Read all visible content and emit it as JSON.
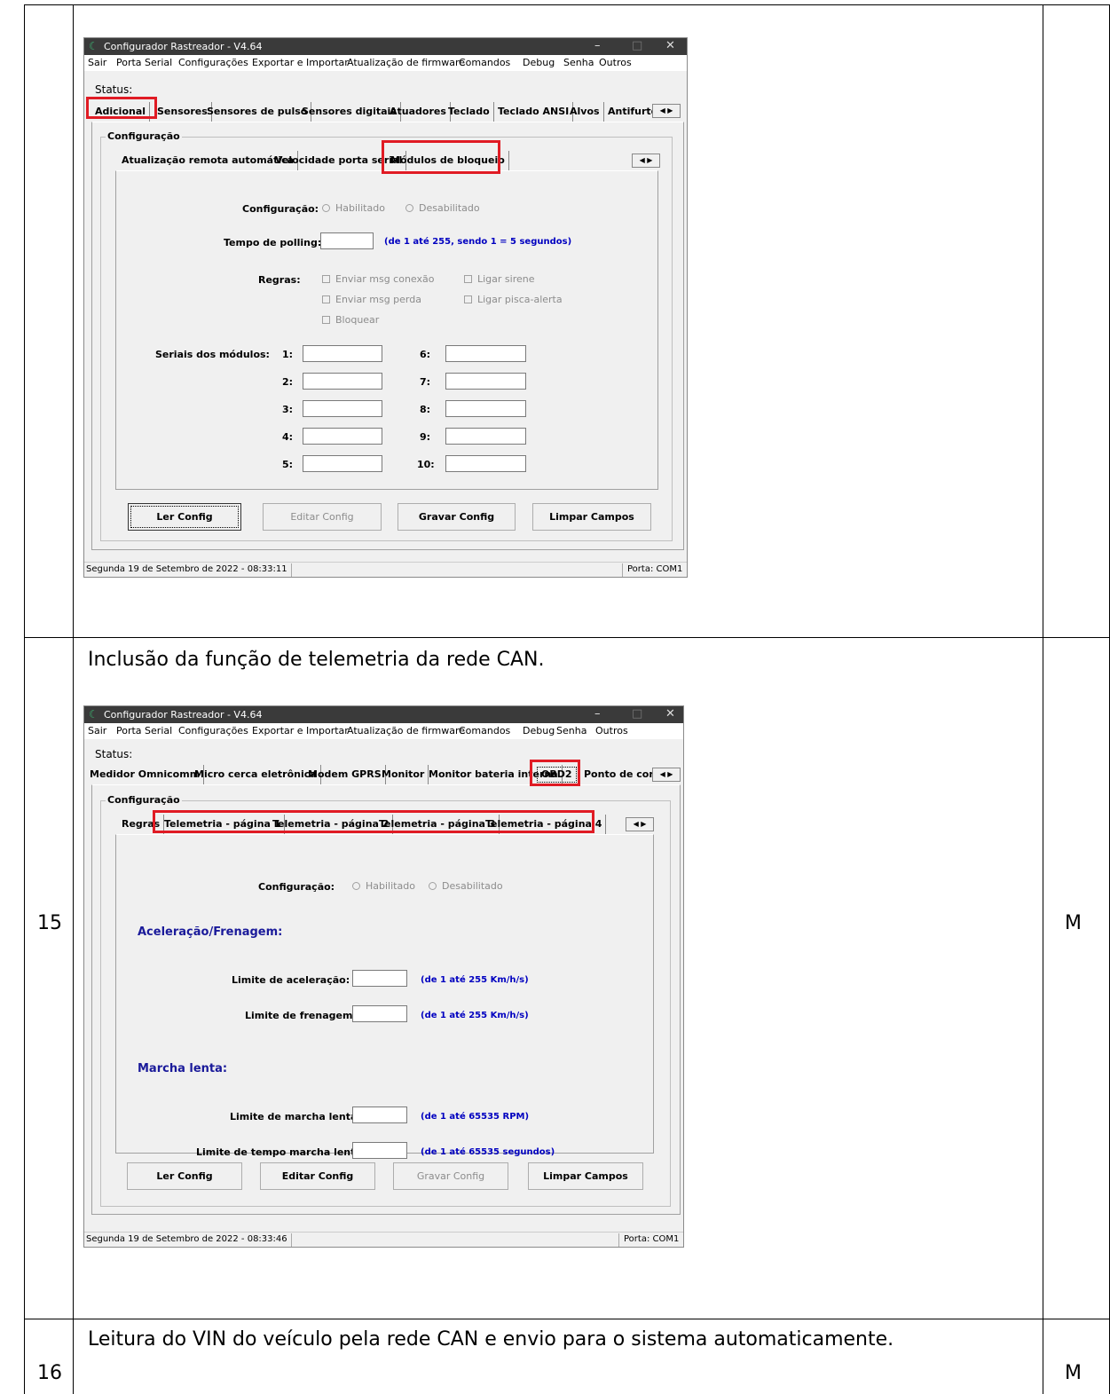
{
  "table": {
    "row1": {
      "num": "",
      "mark": ""
    },
    "row2": {
      "num": "15",
      "mark": "M",
      "description": "Inclusão da função de telemetria da rede CAN."
    },
    "row3": {
      "num": "16",
      "mark": "M",
      "description": "Leitura do VIN do veículo pela rede CAN e envio para o sistema automaticamente."
    }
  },
  "window": {
    "title": "Configurador Rastreador - V4.64",
    "menu": [
      "Sair",
      "Porta Serial",
      "Configurações",
      "Exportar e Importar",
      "Atualização de firmware",
      "Comandos",
      "Debug",
      "Senha",
      "Outros"
    ],
    "status_label": "Status:",
    "group_label": "Configuração",
    "port": "Porta: COM1"
  },
  "shot1": {
    "main_tabs": [
      "Adicional",
      "Sensores",
      "Sensores de pulso",
      "Sensores digitais",
      "Atuadores",
      "Teclado",
      "Teclado ANSI",
      "Alvos",
      "Antifurto"
    ],
    "sub_tabs": [
      "Atualização remota automática",
      "Velocidade porta serial",
      "Módulos de bloqueio"
    ],
    "config_label": "Configuração:",
    "radio_on": "Habilitado",
    "radio_off": "Desabilitado",
    "polling_label": "Tempo de polling:",
    "polling_hint": "(de 1 até 255, sendo 1 = 5 segundos)",
    "rules_label": "Regras:",
    "rules": [
      "Enviar msg conexão",
      "Ligar sirene",
      "Enviar msg perda",
      "Ligar pisca-alerta",
      "Bloquear"
    ],
    "serials_label": "Seriais dos módulos:",
    "serial_nums": [
      "1:",
      "2:",
      "3:",
      "4:",
      "5:",
      "6:",
      "7:",
      "8:",
      "9:",
      "10:"
    ],
    "buttons": [
      "Ler Config",
      "Editar Config",
      "Gravar Config",
      "Limpar Campos"
    ],
    "datetime": "Segunda 19 de Setembro de 2022  -  08:33:11"
  },
  "shot2": {
    "main_tabs": [
      "Medidor Omnicomm",
      "Micro cerca eletrônica",
      "Modem GPRS",
      "Monitor",
      "Monitor bateria interna",
      "OBD2",
      "Ponto de cont"
    ],
    "sub_tabs": [
      "Regras",
      "Telemetria - página 1",
      "Telemetria - página 2",
      "Telemetria - página 3",
      "Telemetria - página 4"
    ],
    "config_label": "Configuração:",
    "radio_on": "Habilitado",
    "radio_off": "Desabilitado",
    "section1": "Aceleração/Frenagem:",
    "accel_label": "Limite de aceleração:",
    "accel_hint": "(de 1 até 255 Km/h/s)",
    "brake_label": "Limite de frenagem:",
    "brake_hint": "(de 1 até 255 Km/h/s)",
    "section2": "Marcha lenta:",
    "idle_label": "Limite de marcha lenta:",
    "idle_hint": "(de 1 até 65535 RPM)",
    "idle_time_label": "Limite de tempo marcha lenta:",
    "idle_time_hint": "(de 1 até 65535 segundos)",
    "buttons": [
      "Ler Config",
      "Editar Config",
      "Gravar Config",
      "Limpar Campos"
    ],
    "datetime": "Segunda 19 de Setembro de 2022  -  08:33:46"
  }
}
